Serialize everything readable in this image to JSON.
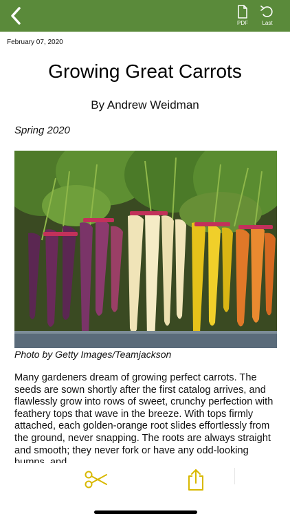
{
  "toolbar": {
    "back_icon": "chevron-left-icon",
    "pdf_label": "PDF",
    "last_label": "Last"
  },
  "article": {
    "date": "February 07, 2020",
    "title": "Growing Great Carrots",
    "byline": "By Andrew Weidman",
    "issue": "Spring 2020",
    "photo_caption": "Photo by Getty Images/Teamjackson",
    "body": "Many gardeners dream of growing perfect carrots. The seeds are sown shortly after the first catalog arrives, and flawlessly grow into rows of sweet, crunchy perfection with feathery tops that wave in the breeze. With tops firmly attached, each golden-orange root slides effortlessly from the ground, never snapping. The roots are always straight and smooth; they never fork or have any odd-looking bumps, and"
  },
  "bottom_bar": {
    "scissors_icon": "scissors-icon",
    "share_icon": "share-icon"
  },
  "colors": {
    "toolbar_bg": "#5a8a3a",
    "accent_yellow": "#d8b800"
  }
}
